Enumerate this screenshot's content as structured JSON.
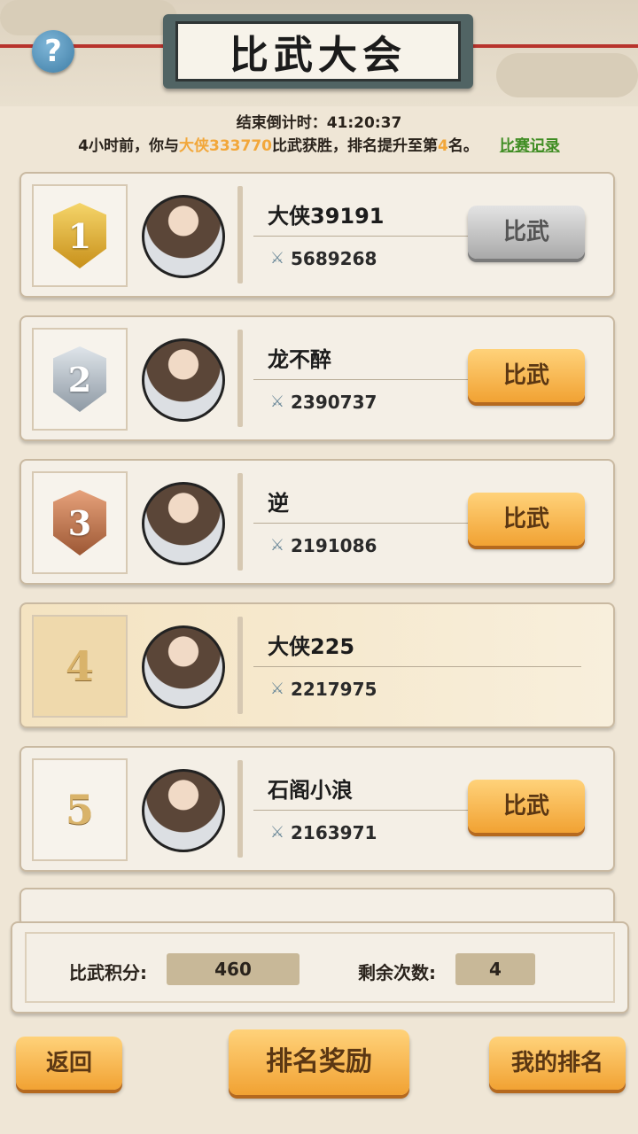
{
  "header": {
    "title": "比武大会",
    "help_label": "?",
    "countdown": "结束倒计时：41:20:37",
    "message": {
      "prefix": "4小时前，你与",
      "opponent": "大侠333770",
      "middle": "比武获胜，排名提升至第",
      "rank": "4",
      "suffix": "名。",
      "link": "比赛记录"
    }
  },
  "players": [
    {
      "rank": "1",
      "name": "大侠39191",
      "power": "5689268",
      "button": "比武"
    },
    {
      "rank": "2",
      "name": "龙不醉",
      "power": "2390737",
      "button": "比武"
    },
    {
      "rank": "3",
      "name": "逆",
      "power": "2191086",
      "button": "比武"
    },
    {
      "rank": "4",
      "name": "大侠225",
      "power": "2217975",
      "button": ""
    },
    {
      "rank": "5",
      "name": "石阁小浪",
      "power": "2163971",
      "button": "比武"
    }
  ],
  "stats": {
    "score_label": "比武积分:",
    "score_value": "460",
    "remaining_label": "剩余次数:",
    "remaining_value": "4"
  },
  "footer": {
    "back": "返回",
    "rewards": "排名奖励",
    "my_rank": "我的排名"
  },
  "colors": {
    "accent_orange": "#f1a233",
    "highlight": "#f2a73a",
    "link_green": "#3f8d23"
  }
}
